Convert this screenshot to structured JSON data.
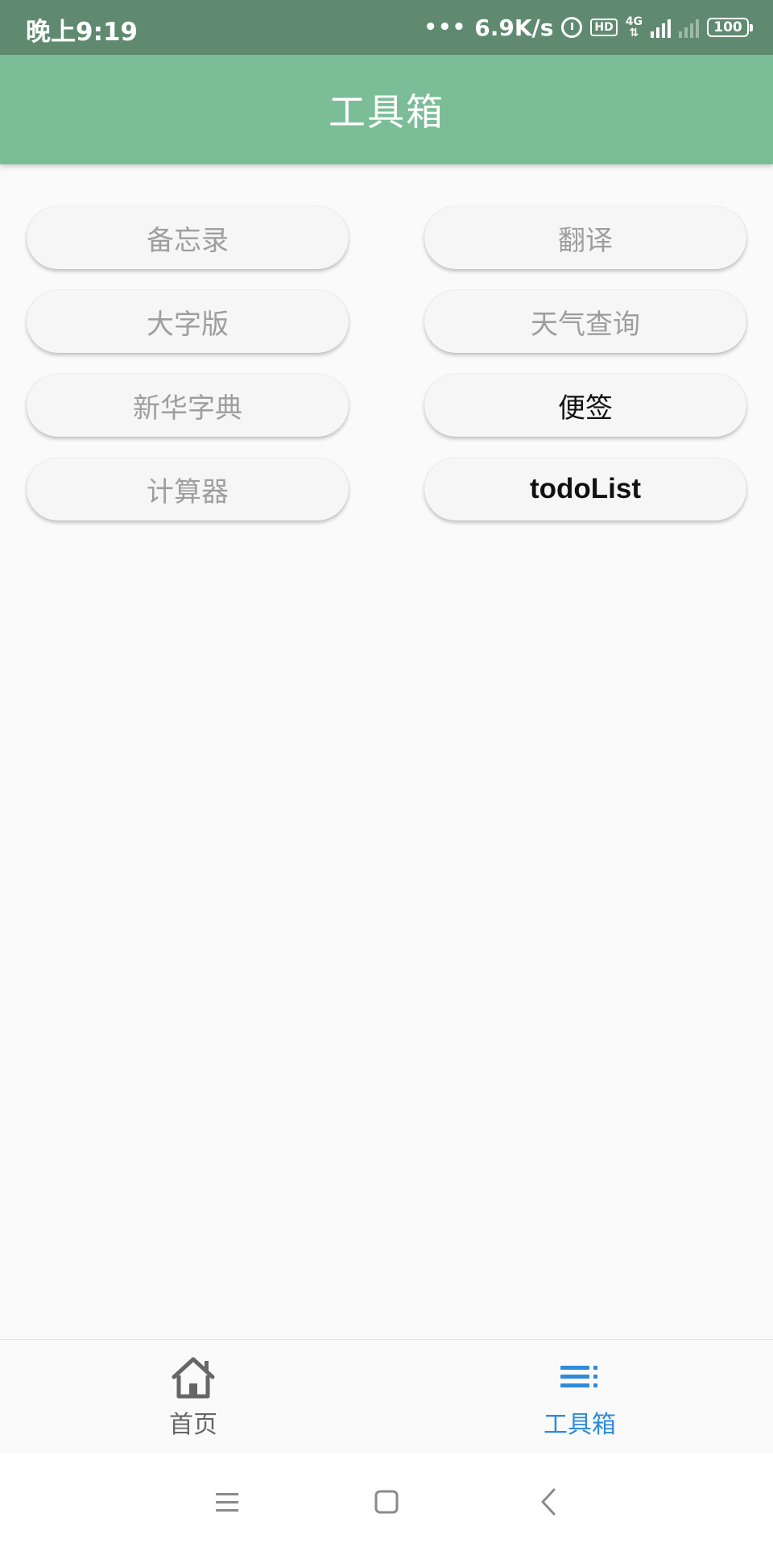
{
  "status_bar": {
    "time": "晚上9:19",
    "net_speed": "6.9K/s",
    "hd_badge": "HD",
    "network_type": "4G",
    "battery": "100"
  },
  "app_bar": {
    "title": "工具箱"
  },
  "tools": [
    {
      "label": "备忘录",
      "enabled": false
    },
    {
      "label": "翻译",
      "enabled": false
    },
    {
      "label": "大字版",
      "enabled": false
    },
    {
      "label": "天气查询",
      "enabled": false
    },
    {
      "label": "新华字典",
      "enabled": false
    },
    {
      "label": "便签",
      "enabled": true
    },
    {
      "label": "计算器",
      "enabled": false
    },
    {
      "label": "todoList",
      "enabled": true
    }
  ],
  "bottom_nav": {
    "items": [
      {
        "label": "首页",
        "icon": "home-icon",
        "selected": false
      },
      {
        "label": "工具箱",
        "icon": "list-icon",
        "selected": true
      }
    ],
    "selected_color": "#2f8bd9"
  },
  "system_nav": {
    "buttons": [
      "menu-icon",
      "home-square-icon",
      "back-icon"
    ]
  },
  "colors": {
    "status_bar": "#5f8a70",
    "app_bar": "#7bbd96",
    "disabled_text": "#9e9e9e",
    "enabled_text": "#111111"
  }
}
